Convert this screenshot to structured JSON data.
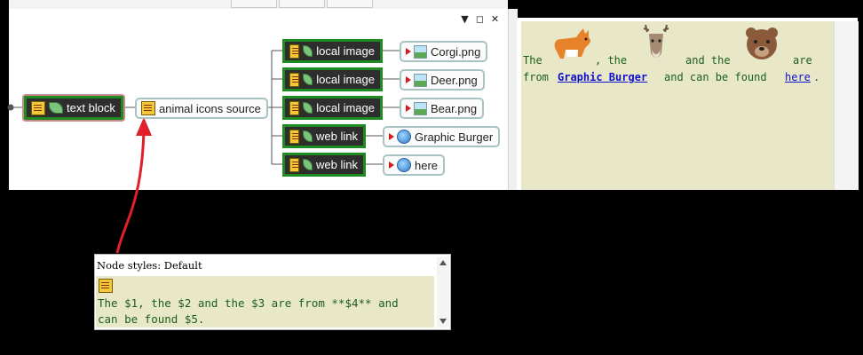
{
  "map": {
    "root_nodes": [
      {
        "label": "text block"
      },
      {
        "label": "animal icons source"
      }
    ],
    "branch_nodes": [
      {
        "label": "local image",
        "link": "Corgi.png"
      },
      {
        "label": "local image",
        "link": "Deer.png"
      },
      {
        "label": "local image",
        "link": "Bear.png"
      },
      {
        "label": "web link",
        "link": "Graphic Burger"
      },
      {
        "label": "web link",
        "link": "here"
      }
    ],
    "panel_controls": [
      "▼",
      "◻",
      "✕"
    ]
  },
  "html_view": {
    "line1": {
      "the1": "The",
      "the2": ", the",
      "and_the": "and the",
      "are": "are"
    },
    "line2": {
      "from": "from",
      "link1": "Graphic Burger",
      "mid": "and can be found",
      "link2": "here",
      "end": "."
    },
    "animals": [
      "corgi-icon",
      "deer-icon",
      "bear-icon"
    ]
  },
  "callout": {
    "title": "Node styles: Default",
    "text_line1": "The $1, the $2 and the $3 are from **$4** and",
    "text_line2": "can be found $5."
  },
  "colors": {
    "accent_green": "#1f8a1f",
    "note_bg": "#e8e8c8",
    "arrow_red": "#e0202a",
    "link_blue": "#1010cc"
  }
}
